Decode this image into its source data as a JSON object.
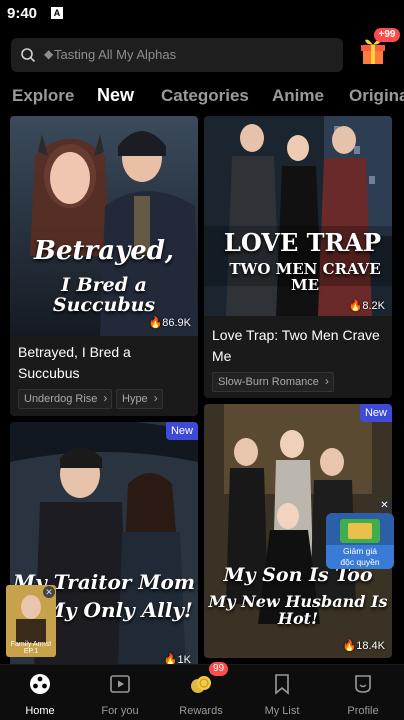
{
  "status_bar": {
    "time": "9:40",
    "app_icon_letter": "A"
  },
  "search": {
    "placeholder_text": "Tasting All My Alphas",
    "icon": "search-icon"
  },
  "gift": {
    "badge": "+99",
    "icon": "gift-icon"
  },
  "tabs": [
    {
      "label": "Explore",
      "active": false
    },
    {
      "label": "New",
      "active": true
    },
    {
      "label": "Categories",
      "active": false
    },
    {
      "label": "Anime",
      "active": false
    },
    {
      "label": "Originals",
      "active": false
    }
  ],
  "cards": [
    {
      "poster_title_line1": "Betrayed,",
      "poster_title_line2": "I Bred a Succubus",
      "views": "86.9K",
      "title": "Betrayed, I Bred a Succubus",
      "tags": [
        "Underdog Rise",
        "Hype"
      ],
      "new": false
    },
    {
      "poster_title_line1": "LOVE TRAP",
      "poster_title_line2": "TWO MEN CRAVE ME",
      "views": "8.2K",
      "title": "Love Trap: Two Men Crave Me",
      "tags": [
        "Slow-Burn Romance"
      ],
      "new": false
    },
    {
      "poster_title_line1": "My Traitor Mom",
      "poster_title_line2": "Is My Only Ally!",
      "views": "1K",
      "new": true,
      "new_label": "New"
    },
    {
      "poster_title_line1": "My Son Is Too",
      "poster_title_line2": "My New Husband Is Hot!",
      "views": "18.4K",
      "new": true,
      "new_label": "New"
    }
  ],
  "mini_player": {
    "caption": "Family Armst",
    "episode": "EP.1"
  },
  "promo": {
    "line1": "Giảm giá",
    "line2": "độc quyền"
  },
  "bottom_nav": [
    {
      "label": "Home",
      "icon": "home-icon",
      "active": true
    },
    {
      "label": "For you",
      "icon": "play-square-icon",
      "active": false
    },
    {
      "label": "Rewards",
      "icon": "coins-icon",
      "active": false,
      "badge": "99"
    },
    {
      "label": "My List",
      "icon": "bookmark-icon",
      "active": false
    },
    {
      "label": "Profile",
      "icon": "profile-icon",
      "active": false
    }
  ],
  "colors": {
    "accent_new": "#3f4bd6",
    "badge_red": "#ff4b4b",
    "card_bg": "#1a1a1a"
  }
}
